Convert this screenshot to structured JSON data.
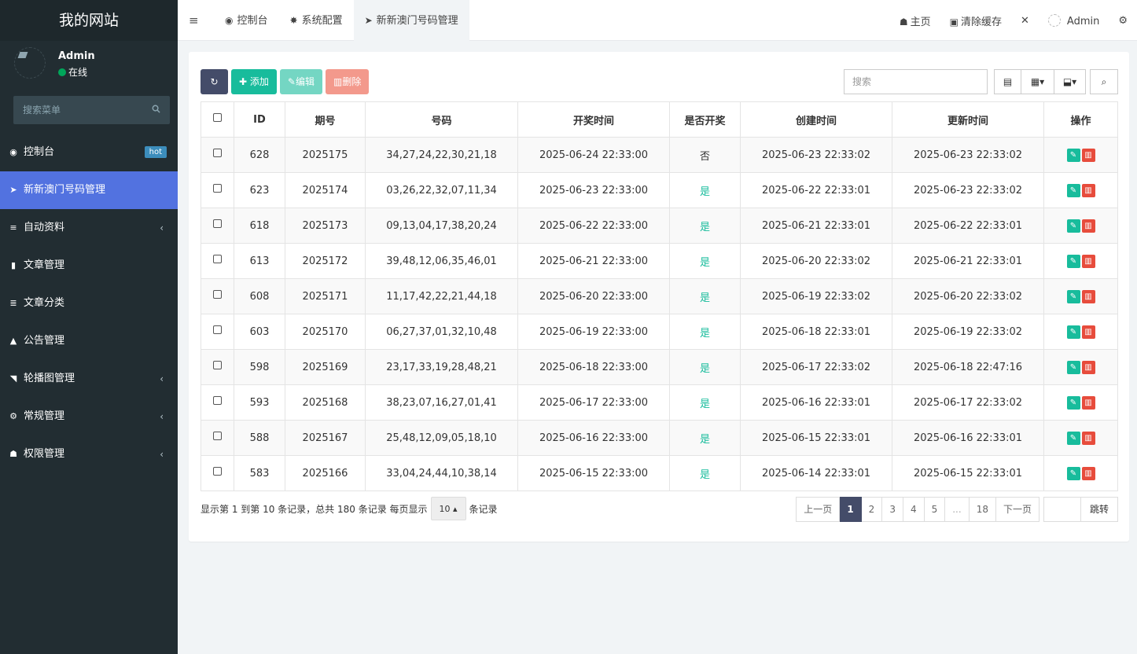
{
  "sidebar": {
    "logo": "我的网站",
    "user": {
      "name": "Admin",
      "status": "在线"
    },
    "search_placeholder": "搜索菜单",
    "items": [
      {
        "label": "控制台",
        "icon": "dashboard-icon",
        "glyph": "◉",
        "badge": "hot",
        "chevron": false
      },
      {
        "label": "新新澳门号码管理",
        "icon": "paper-plane-icon",
        "glyph": "➤",
        "active": true,
        "chevron": false
      },
      {
        "label": "自动资料",
        "icon": "list-icon",
        "glyph": "≡",
        "chevron": true
      },
      {
        "label": "文章管理",
        "icon": "bookmark-icon",
        "glyph": "▮",
        "chevron": false
      },
      {
        "label": "文章分类",
        "icon": "list-icon",
        "glyph": "≣",
        "chevron": false
      },
      {
        "label": "公告管理",
        "icon": "bell-icon",
        "glyph": "▲",
        "chevron": false
      },
      {
        "label": "轮播图管理",
        "icon": "image-icon",
        "glyph": "◥",
        "chevron": true
      },
      {
        "label": "常规管理",
        "icon": "cogs-icon",
        "glyph": "⚙",
        "chevron": true
      },
      {
        "label": "权限管理",
        "icon": "group-icon",
        "glyph": "☗",
        "chevron": true
      }
    ]
  },
  "header": {
    "tabs": [
      {
        "label": "控制台",
        "icon": "dashboard-icon",
        "glyph": "◉"
      },
      {
        "label": "系统配置",
        "icon": "gear-icon",
        "glyph": "✸"
      },
      {
        "label": "新新澳门号码管理",
        "icon": "paper-plane-icon",
        "glyph": "➤",
        "active": true
      }
    ],
    "right": {
      "home": "主页",
      "clear_cache": "清除缓存",
      "user": "Admin"
    }
  },
  "toolbar": {
    "add": "添加",
    "edit": "编辑",
    "delete": "删除",
    "search_placeholder": "搜索"
  },
  "table": {
    "columns": [
      "ID",
      "期号",
      "号码",
      "开奖时间",
      "是否开奖",
      "创建时间",
      "更新时间",
      "操作"
    ],
    "rows": [
      [
        "628",
        "2025175",
        "34,27,24,22,30,21,18",
        "2025-06-24 22:33:00",
        "否",
        "2025-06-23 22:33:02",
        "2025-06-23 22:33:02"
      ],
      [
        "623",
        "2025174",
        "03,26,22,32,07,11,34",
        "2025-06-23 22:33:00",
        "是",
        "2025-06-22 22:33:01",
        "2025-06-23 22:33:02"
      ],
      [
        "618",
        "2025173",
        "09,13,04,17,38,20,24",
        "2025-06-22 22:33:00",
        "是",
        "2025-06-21 22:33:01",
        "2025-06-22 22:33:01"
      ],
      [
        "613",
        "2025172",
        "39,48,12,06,35,46,01",
        "2025-06-21 22:33:00",
        "是",
        "2025-06-20 22:33:02",
        "2025-06-21 22:33:01"
      ],
      [
        "608",
        "2025171",
        "11,17,42,22,21,44,18",
        "2025-06-20 22:33:00",
        "是",
        "2025-06-19 22:33:02",
        "2025-06-20 22:33:02"
      ],
      [
        "603",
        "2025170",
        "06,27,37,01,32,10,48",
        "2025-06-19 22:33:00",
        "是",
        "2025-06-18 22:33:01",
        "2025-06-19 22:33:02"
      ],
      [
        "598",
        "2025169",
        "23,17,33,19,28,48,21",
        "2025-06-18 22:33:00",
        "是",
        "2025-06-17 22:33:02",
        "2025-06-18 22:47:16"
      ],
      [
        "593",
        "2025168",
        "38,23,07,16,27,01,41",
        "2025-06-17 22:33:00",
        "是",
        "2025-06-16 22:33:01",
        "2025-06-17 22:33:02"
      ],
      [
        "588",
        "2025167",
        "25,48,12,09,05,18,10",
        "2025-06-16 22:33:00",
        "是",
        "2025-06-15 22:33:01",
        "2025-06-16 22:33:01"
      ],
      [
        "583",
        "2025166",
        "33,04,24,44,10,38,14",
        "2025-06-15 22:33:00",
        "是",
        "2025-06-14 22:33:01",
        "2025-06-15 22:33:01"
      ]
    ]
  },
  "footer": {
    "info": "显示第 1 到第 10 条记录，总共 180 条记录 每页显示",
    "page_size": "10",
    "info_suffix": "条记录",
    "prev": "上一页",
    "next": "下一页",
    "pages": [
      "1",
      "2",
      "3",
      "4",
      "5",
      "...",
      "18"
    ],
    "current_page": "1",
    "jump": "跳转"
  },
  "colors": {
    "sidebar_bg": "#222d32",
    "active_menu": "#5272e0",
    "success": "#18bc9c",
    "danger": "#e74c3c",
    "dark_btn": "#444c69"
  }
}
